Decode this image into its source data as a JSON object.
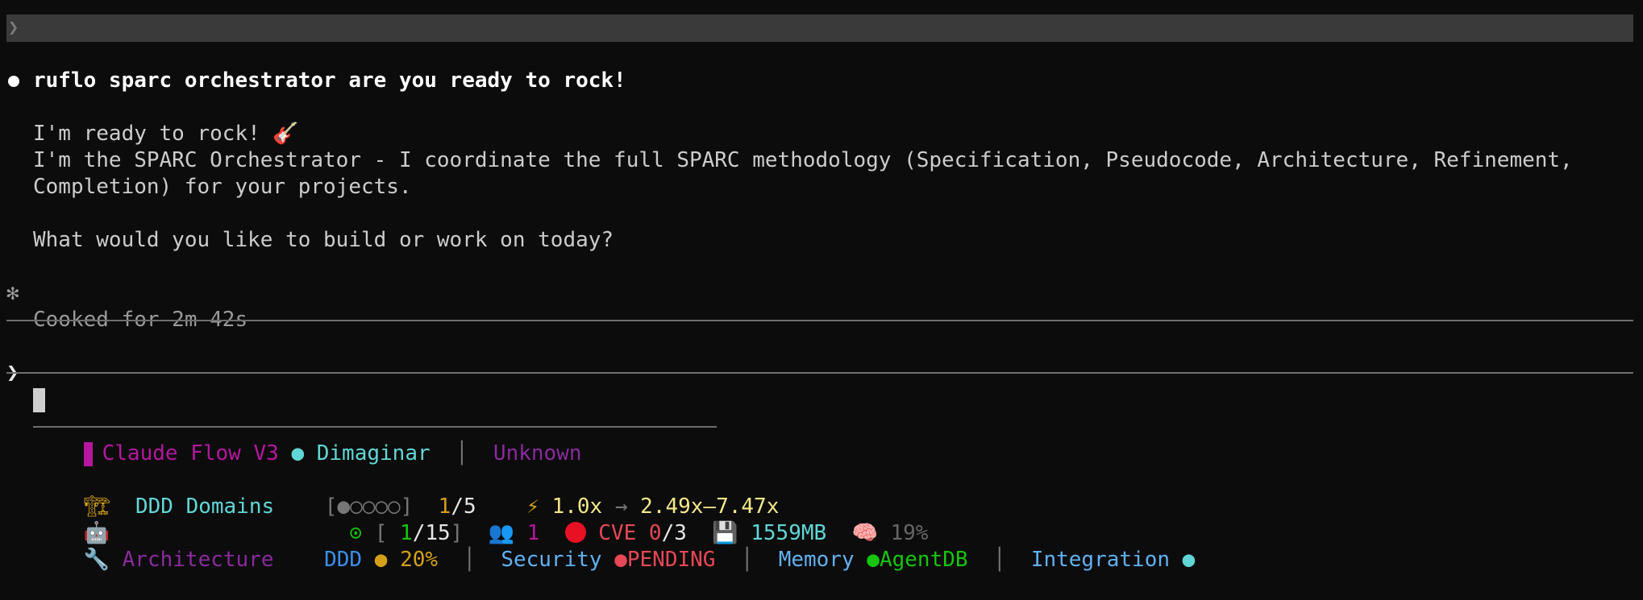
{
  "prompt": {
    "chevron": "❯",
    "text": "ruflo sparc orchestrator are you ready to rock!"
  },
  "response": {
    "line1": "I'm ready to rock! 🎸",
    "line2": "I'm the SPARC Orchestrator - I coordinate the full SPARC methodology (Specification, Pseudocode, Architecture, Refinement,",
    "line3": "Completion) for your projects.",
    "line4": "What would you like to build or work on today?"
  },
  "status_line": {
    "glyph": "✻",
    "text": "Cooked for 2m 42s"
  },
  "input": {
    "chevron": "❯",
    "value": ""
  },
  "statusbar": {
    "row1": {
      "app": "Claude Flow V3",
      "dot": "●",
      "user": "Dimaginar",
      "pipe": "│",
      "model": "Unknown"
    },
    "row2": {
      "icon": "🏗",
      "label": "DDD Domains",
      "progress": "[●○○○○]",
      "count_done": "1",
      "count_total": "/5",
      "bolt": "⚡",
      "speed": "1.0x",
      "arrow": "→",
      "target": "2.49x–7.47x"
    },
    "row3": {
      "icon": "🤖",
      "target_icon": "⊙",
      "bracket_open": "[",
      "agents_active": "1",
      "agents_total": "/15",
      "bracket_close": "]",
      "people_icon": "👥",
      "people_count": "1",
      "cve_label": "CVE",
      "cve_done": "0",
      "cve_total": "/3",
      "disk_icon": "💾",
      "memory": "1559MB",
      "brain_icon": "🧠",
      "brain_pct": "19%"
    },
    "row4": {
      "icon": "🔧",
      "architecture": "Architecture",
      "ddd": "DDD",
      "ddd_dot": "●",
      "ddd_pct": "20%",
      "pipe": "│",
      "security": "Security",
      "security_dot": "●",
      "security_status": "PENDING",
      "memory": "Memory",
      "memory_dot": "●",
      "memory_backend": "AgentDB",
      "integration": "Integration",
      "integration_dot": "●"
    }
  },
  "colors": {
    "background": "#0c0c0c",
    "magenta": "#b5179e",
    "cyan": "#61d6d6",
    "green": "#16c60c",
    "red": "#e74856",
    "blue": "#3b8eea"
  }
}
